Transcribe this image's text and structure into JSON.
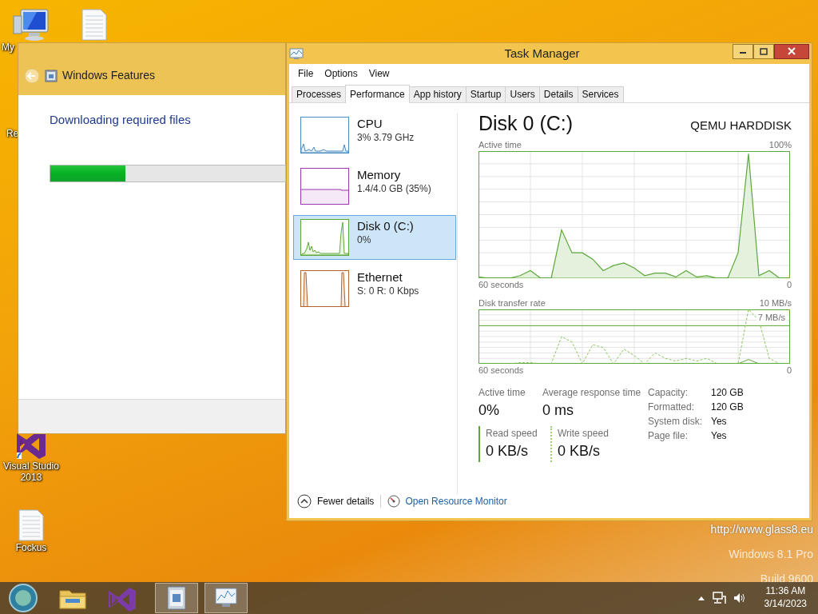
{
  "desktop": {
    "icons": [
      {
        "kind": "computer",
        "label": "My"
      },
      {
        "kind": "document"
      },
      {
        "kind": "none",
        "label": "Re"
      },
      {
        "kind": "vs",
        "label": "Visual Studio 2013"
      },
      {
        "kind": "document",
        "label": "Fockus"
      }
    ],
    "branding": {
      "url": "http://www.glass8.eu",
      "edition": "Windows 8.1 Pro",
      "build": "Build 9600"
    }
  },
  "features_window": {
    "title": "Windows Features",
    "heading": "Downloading required files",
    "progress": {
      "level": 0.32
    }
  },
  "task_manager": {
    "title": "Task Manager",
    "menu": [
      "File",
      "Options",
      "View"
    ],
    "tabs": [
      {
        "label": "Processes",
        "selected": false
      },
      {
        "label": "Performance",
        "selected": true
      },
      {
        "label": "App history",
        "selected": false
      },
      {
        "label": "Startup",
        "selected": false
      },
      {
        "label": "Users",
        "selected": false
      },
      {
        "label": "Details",
        "selected": false
      },
      {
        "label": "Services",
        "selected": false
      }
    ],
    "resources": [
      {
        "kind": "cpu",
        "name": "CPU",
        "detail": "3% 3.79 GHz",
        "color": "#4a8bbd",
        "selected": false
      },
      {
        "kind": "memory",
        "name": "Memory",
        "detail": "1.4/4.0 GB (35%)",
        "color": "#9b3ab0",
        "selected": false
      },
      {
        "kind": "disk",
        "name": "Disk 0 (C:)",
        "detail": "0%",
        "color": "#5ca83a",
        "selected": true
      },
      {
        "kind": "network",
        "name": "Ethernet",
        "detail": "S: 0 R: 0 Kbps",
        "color": "#b0622a",
        "selected": false
      }
    ],
    "detail": {
      "title": "Disk 0 (C:)",
      "model": "QEMU HARDDISK",
      "graphs": [
        {
          "kind": "area",
          "title": "Active time",
          "max_label": "100%",
          "time_label": "60 seconds",
          "min_label": "0"
        },
        {
          "kind": "lines",
          "title": "Disk transfer rate",
          "max_label": "10 MB/s",
          "marker_label": "7 MB/s",
          "time_label": "60 seconds",
          "min_label": "0"
        }
      ],
      "stats": [
        {
          "label": "Active time",
          "value": "0%"
        },
        {
          "label": "Average response time",
          "value": "0 ms"
        }
      ],
      "speeds": [
        {
          "kind": "solid",
          "label": "Read speed",
          "value": "0 KB/s"
        },
        {
          "kind": "dashed",
          "label": "Write speed",
          "value": "0 KB/s"
        }
      ],
      "properties": [
        {
          "label": "Capacity:",
          "value": "120 GB"
        },
        {
          "label": "Formatted:",
          "value": "120 GB"
        },
        {
          "label": "System disk:",
          "value": "Yes"
        },
        {
          "label": "Page file:",
          "value": "Yes"
        }
      ]
    },
    "footer": {
      "fewer_details": "Fewer details",
      "resource_monitor": "Open Resource Monitor"
    }
  },
  "taskbar": {
    "apps": [
      {
        "kind": "start",
        "running": false
      },
      {
        "kind": "explorer",
        "running": false
      },
      {
        "kind": "vs",
        "running": false
      },
      {
        "kind": "features",
        "running": true
      },
      {
        "kind": "taskmgr",
        "running": true
      }
    ],
    "clock": {
      "time": "11:36 AM",
      "date": "3/14/2023"
    }
  }
}
